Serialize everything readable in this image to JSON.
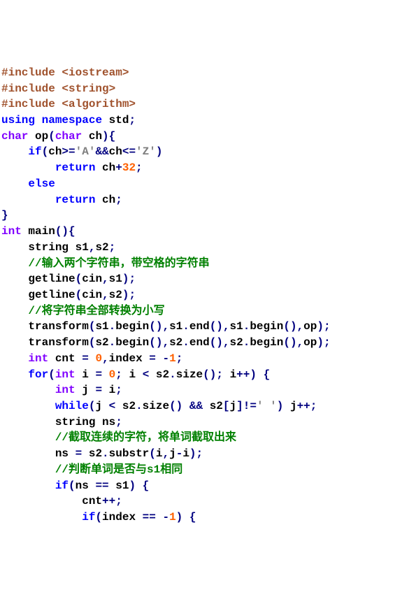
{
  "code": {
    "lines": [
      [
        {
          "cls": "preproc",
          "t": "#include <iostream>"
        }
      ],
      [
        {
          "cls": "preproc",
          "t": "#include <string>"
        }
      ],
      [
        {
          "cls": "preproc",
          "t": "#include <algorithm>"
        }
      ],
      [
        {
          "cls": "kw",
          "t": "using"
        },
        {
          "cls": "",
          "t": " "
        },
        {
          "cls": "kw",
          "t": "namespace"
        },
        {
          "cls": "",
          "t": " "
        },
        {
          "cls": "ident",
          "t": "std"
        },
        {
          "cls": "op",
          "t": ";"
        }
      ],
      [
        {
          "cls": "type",
          "t": "char"
        },
        {
          "cls": "",
          "t": " "
        },
        {
          "cls": "ident",
          "t": "op"
        },
        {
          "cls": "paren",
          "t": "("
        },
        {
          "cls": "type",
          "t": "char"
        },
        {
          "cls": "",
          "t": " "
        },
        {
          "cls": "ident",
          "t": "ch"
        },
        {
          "cls": "paren",
          "t": ")"
        },
        {
          "cls": "paren",
          "t": "{"
        }
      ],
      [
        {
          "cls": "",
          "t": "    "
        },
        {
          "cls": "kw",
          "t": "if"
        },
        {
          "cls": "paren",
          "t": "("
        },
        {
          "cls": "ident",
          "t": "ch"
        },
        {
          "cls": "op",
          "t": ">="
        },
        {
          "cls": "str",
          "t": "'A'"
        },
        {
          "cls": "op",
          "t": "&&"
        },
        {
          "cls": "ident",
          "t": "ch"
        },
        {
          "cls": "op",
          "t": "<="
        },
        {
          "cls": "str",
          "t": "'Z'"
        },
        {
          "cls": "paren",
          "t": ")"
        }
      ],
      [
        {
          "cls": "",
          "t": "        "
        },
        {
          "cls": "kw",
          "t": "return"
        },
        {
          "cls": "",
          "t": " "
        },
        {
          "cls": "ident",
          "t": "ch"
        },
        {
          "cls": "op",
          "t": "+"
        },
        {
          "cls": "num",
          "t": "32"
        },
        {
          "cls": "op",
          "t": ";"
        }
      ],
      [
        {
          "cls": "",
          "t": "    "
        },
        {
          "cls": "kw",
          "t": "else"
        }
      ],
      [
        {
          "cls": "",
          "t": "        "
        },
        {
          "cls": "kw",
          "t": "return"
        },
        {
          "cls": "",
          "t": " "
        },
        {
          "cls": "ident",
          "t": "ch"
        },
        {
          "cls": "op",
          "t": ";"
        }
      ],
      [
        {
          "cls": "paren",
          "t": "}"
        }
      ],
      [
        {
          "cls": "type",
          "t": "int"
        },
        {
          "cls": "",
          "t": " "
        },
        {
          "cls": "ident",
          "t": "main"
        },
        {
          "cls": "paren",
          "t": "()"
        },
        {
          "cls": "paren",
          "t": "{"
        }
      ],
      [
        {
          "cls": "",
          "t": "    "
        },
        {
          "cls": "ident",
          "t": "string s1"
        },
        {
          "cls": "op",
          "t": ","
        },
        {
          "cls": "ident",
          "t": "s2"
        },
        {
          "cls": "op",
          "t": ";"
        }
      ],
      [
        {
          "cls": "",
          "t": "    "
        },
        {
          "cls": "cmt",
          "t": "//输入两个字符串，带空格的字符串"
        }
      ],
      [
        {
          "cls": "",
          "t": "    "
        },
        {
          "cls": "ident",
          "t": "getline"
        },
        {
          "cls": "paren",
          "t": "("
        },
        {
          "cls": "ident",
          "t": "cin"
        },
        {
          "cls": "op",
          "t": ","
        },
        {
          "cls": "ident",
          "t": "s1"
        },
        {
          "cls": "paren",
          "t": ")"
        },
        {
          "cls": "op",
          "t": ";"
        }
      ],
      [
        {
          "cls": "",
          "t": "    "
        },
        {
          "cls": "ident",
          "t": "getline"
        },
        {
          "cls": "paren",
          "t": "("
        },
        {
          "cls": "ident",
          "t": "cin"
        },
        {
          "cls": "op",
          "t": ","
        },
        {
          "cls": "ident",
          "t": "s2"
        },
        {
          "cls": "paren",
          "t": ")"
        },
        {
          "cls": "op",
          "t": ";"
        }
      ],
      [
        {
          "cls": "",
          "t": "    "
        },
        {
          "cls": "cmt",
          "t": "//将字符串全部转换为小写"
        }
      ],
      [
        {
          "cls": "",
          "t": "    "
        },
        {
          "cls": "ident",
          "t": "transform"
        },
        {
          "cls": "paren",
          "t": "("
        },
        {
          "cls": "ident",
          "t": "s1"
        },
        {
          "cls": "op",
          "t": "."
        },
        {
          "cls": "ident",
          "t": "begin"
        },
        {
          "cls": "paren",
          "t": "()"
        },
        {
          "cls": "op",
          "t": ","
        },
        {
          "cls": "ident",
          "t": "s1"
        },
        {
          "cls": "op",
          "t": "."
        },
        {
          "cls": "ident",
          "t": "end"
        },
        {
          "cls": "paren",
          "t": "()"
        },
        {
          "cls": "op",
          "t": ","
        },
        {
          "cls": "ident",
          "t": "s1"
        },
        {
          "cls": "op",
          "t": "."
        },
        {
          "cls": "ident",
          "t": "begin"
        },
        {
          "cls": "paren",
          "t": "()"
        },
        {
          "cls": "op",
          "t": ","
        },
        {
          "cls": "ident",
          "t": "op"
        },
        {
          "cls": "paren",
          "t": ")"
        },
        {
          "cls": "op",
          "t": ";"
        }
      ],
      [
        {
          "cls": "",
          "t": "    "
        },
        {
          "cls": "ident",
          "t": "transform"
        },
        {
          "cls": "paren",
          "t": "("
        },
        {
          "cls": "ident",
          "t": "s2"
        },
        {
          "cls": "op",
          "t": "."
        },
        {
          "cls": "ident",
          "t": "begin"
        },
        {
          "cls": "paren",
          "t": "()"
        },
        {
          "cls": "op",
          "t": ","
        },
        {
          "cls": "ident",
          "t": "s2"
        },
        {
          "cls": "op",
          "t": "."
        },
        {
          "cls": "ident",
          "t": "end"
        },
        {
          "cls": "paren",
          "t": "()"
        },
        {
          "cls": "op",
          "t": ","
        },
        {
          "cls": "ident",
          "t": "s2"
        },
        {
          "cls": "op",
          "t": "."
        },
        {
          "cls": "ident",
          "t": "begin"
        },
        {
          "cls": "paren",
          "t": "()"
        },
        {
          "cls": "op",
          "t": ","
        },
        {
          "cls": "ident",
          "t": "op"
        },
        {
          "cls": "paren",
          "t": ")"
        },
        {
          "cls": "op",
          "t": ";"
        }
      ],
      [
        {
          "cls": "",
          "t": "    "
        },
        {
          "cls": "type",
          "t": "int"
        },
        {
          "cls": "",
          "t": " "
        },
        {
          "cls": "ident",
          "t": "cnt "
        },
        {
          "cls": "op",
          "t": "="
        },
        {
          "cls": "",
          "t": " "
        },
        {
          "cls": "num",
          "t": "0"
        },
        {
          "cls": "op",
          "t": ","
        },
        {
          "cls": "ident",
          "t": "index "
        },
        {
          "cls": "op",
          "t": "="
        },
        {
          "cls": "",
          "t": " "
        },
        {
          "cls": "op",
          "t": "-"
        },
        {
          "cls": "num",
          "t": "1"
        },
        {
          "cls": "op",
          "t": ";"
        }
      ],
      [
        {
          "cls": "",
          "t": "    "
        },
        {
          "cls": "kw",
          "t": "for"
        },
        {
          "cls": "paren",
          "t": "("
        },
        {
          "cls": "type",
          "t": "int"
        },
        {
          "cls": "",
          "t": " "
        },
        {
          "cls": "ident",
          "t": "i "
        },
        {
          "cls": "op",
          "t": "="
        },
        {
          "cls": "",
          "t": " "
        },
        {
          "cls": "num",
          "t": "0"
        },
        {
          "cls": "op",
          "t": ";"
        },
        {
          "cls": "",
          "t": " "
        },
        {
          "cls": "ident",
          "t": "i "
        },
        {
          "cls": "op",
          "t": "<"
        },
        {
          "cls": "",
          "t": " "
        },
        {
          "cls": "ident",
          "t": "s2"
        },
        {
          "cls": "op",
          "t": "."
        },
        {
          "cls": "ident",
          "t": "size"
        },
        {
          "cls": "paren",
          "t": "()"
        },
        {
          "cls": "op",
          "t": ";"
        },
        {
          "cls": "",
          "t": " "
        },
        {
          "cls": "ident",
          "t": "i"
        },
        {
          "cls": "op",
          "t": "++"
        },
        {
          "cls": "paren",
          "t": ")"
        },
        {
          "cls": "",
          "t": " "
        },
        {
          "cls": "paren",
          "t": "{"
        }
      ],
      [
        {
          "cls": "",
          "t": "        "
        },
        {
          "cls": "type",
          "t": "int"
        },
        {
          "cls": "",
          "t": " "
        },
        {
          "cls": "ident",
          "t": "j "
        },
        {
          "cls": "op",
          "t": "="
        },
        {
          "cls": "",
          "t": " "
        },
        {
          "cls": "ident",
          "t": "i"
        },
        {
          "cls": "op",
          "t": ";"
        }
      ],
      [
        {
          "cls": "",
          "t": "        "
        },
        {
          "cls": "kw",
          "t": "while"
        },
        {
          "cls": "paren",
          "t": "("
        },
        {
          "cls": "ident",
          "t": "j "
        },
        {
          "cls": "op",
          "t": "<"
        },
        {
          "cls": "",
          "t": " "
        },
        {
          "cls": "ident",
          "t": "s2"
        },
        {
          "cls": "op",
          "t": "."
        },
        {
          "cls": "ident",
          "t": "size"
        },
        {
          "cls": "paren",
          "t": "()"
        },
        {
          "cls": "",
          "t": " "
        },
        {
          "cls": "op",
          "t": "&&"
        },
        {
          "cls": "",
          "t": " "
        },
        {
          "cls": "ident",
          "t": "s2"
        },
        {
          "cls": "paren",
          "t": "["
        },
        {
          "cls": "ident",
          "t": "j"
        },
        {
          "cls": "paren",
          "t": "]"
        },
        {
          "cls": "op",
          "t": "!="
        },
        {
          "cls": "str",
          "t": "' '"
        },
        {
          "cls": "paren",
          "t": ")"
        },
        {
          "cls": "",
          "t": " "
        },
        {
          "cls": "ident",
          "t": "j"
        },
        {
          "cls": "op",
          "t": "++;"
        }
      ],
      [
        {
          "cls": "",
          "t": "        "
        },
        {
          "cls": "ident",
          "t": "string ns"
        },
        {
          "cls": "op",
          "t": ";"
        }
      ],
      [
        {
          "cls": "",
          "t": "        "
        },
        {
          "cls": "cmt",
          "t": "//截取连续的字符，将单词截取出来"
        }
      ],
      [
        {
          "cls": "",
          "t": "        "
        },
        {
          "cls": "ident",
          "t": "ns "
        },
        {
          "cls": "op",
          "t": "="
        },
        {
          "cls": "",
          "t": " "
        },
        {
          "cls": "ident",
          "t": "s2"
        },
        {
          "cls": "op",
          "t": "."
        },
        {
          "cls": "ident",
          "t": "substr"
        },
        {
          "cls": "paren",
          "t": "("
        },
        {
          "cls": "ident",
          "t": "i"
        },
        {
          "cls": "op",
          "t": ","
        },
        {
          "cls": "ident",
          "t": "j"
        },
        {
          "cls": "op",
          "t": "-"
        },
        {
          "cls": "ident",
          "t": "i"
        },
        {
          "cls": "paren",
          "t": ")"
        },
        {
          "cls": "op",
          "t": ";"
        }
      ],
      [
        {
          "cls": "",
          "t": "        "
        },
        {
          "cls": "cmt",
          "t": "//判断单词是否与s1相同"
        }
      ],
      [
        {
          "cls": "",
          "t": "        "
        },
        {
          "cls": "kw",
          "t": "if"
        },
        {
          "cls": "paren",
          "t": "("
        },
        {
          "cls": "ident",
          "t": "ns "
        },
        {
          "cls": "op",
          "t": "=="
        },
        {
          "cls": "",
          "t": " "
        },
        {
          "cls": "ident",
          "t": "s1"
        },
        {
          "cls": "paren",
          "t": ")"
        },
        {
          "cls": "",
          "t": " "
        },
        {
          "cls": "paren",
          "t": "{"
        }
      ],
      [
        {
          "cls": "",
          "t": "            "
        },
        {
          "cls": "ident",
          "t": "cnt"
        },
        {
          "cls": "op",
          "t": "++;"
        }
      ],
      [
        {
          "cls": "",
          "t": "            "
        },
        {
          "cls": "kw",
          "t": "if"
        },
        {
          "cls": "paren",
          "t": "("
        },
        {
          "cls": "ident",
          "t": "index "
        },
        {
          "cls": "op",
          "t": "=="
        },
        {
          "cls": "",
          "t": " "
        },
        {
          "cls": "op",
          "t": "-"
        },
        {
          "cls": "num",
          "t": "1"
        },
        {
          "cls": "paren",
          "t": ")"
        },
        {
          "cls": "",
          "t": " "
        },
        {
          "cls": "paren",
          "t": "{"
        }
      ]
    ]
  }
}
